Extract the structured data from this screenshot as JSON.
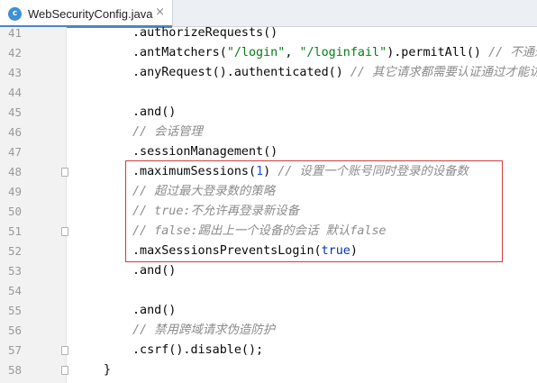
{
  "tab": {
    "icon_letter": "c",
    "title": "WebSecurityConfig.java",
    "close_glyph": "×"
  },
  "lines": [
    {
      "n": "41",
      "indent": "        ",
      "parts": [
        {
          "t": ".authorizeRequests()",
          "c": ""
        }
      ]
    },
    {
      "n": "42",
      "indent": "        ",
      "parts": [
        {
          "t": ".antMatchers(",
          "c": ""
        },
        {
          "t": "\"/login\"",
          "c": "str"
        },
        {
          "t": ", ",
          "c": ""
        },
        {
          "t": "\"/loginfail\"",
          "c": "str"
        },
        {
          "t": ").permitAll() ",
          "c": ""
        },
        {
          "t": "// 不通过",
          "c": "cmt"
        }
      ]
    },
    {
      "n": "43",
      "indent": "        ",
      "parts": [
        {
          "t": ".anyRequest().authenticated() ",
          "c": ""
        },
        {
          "t": "// 其它请求都需要认证通过才能访",
          "c": "cmt"
        }
      ]
    },
    {
      "n": "44",
      "indent": "",
      "parts": []
    },
    {
      "n": "45",
      "indent": "        ",
      "parts": [
        {
          "t": ".and()",
          "c": ""
        }
      ]
    },
    {
      "n": "46",
      "indent": "        ",
      "parts": [
        {
          "t": "// 会话管理",
          "c": "cmt"
        }
      ]
    },
    {
      "n": "47",
      "indent": "        ",
      "parts": [
        {
          "t": ".sessionManagement()",
          "c": ""
        }
      ]
    },
    {
      "n": "48",
      "indent": "        ",
      "fold": true,
      "parts": [
        {
          "t": ".maximumSessions(",
          "c": ""
        },
        {
          "t": "1",
          "c": "num"
        },
        {
          "t": ") ",
          "c": ""
        },
        {
          "t": "// 设置一个账号同时登录的设备数",
          "c": "cmt"
        }
      ]
    },
    {
      "n": "49",
      "indent": "        ",
      "parts": [
        {
          "t": "// 超过最大登录数的策略",
          "c": "cmt"
        }
      ]
    },
    {
      "n": "50",
      "indent": "        ",
      "parts": [
        {
          "t": "// true:不允许再登录新设备",
          "c": "cmt"
        }
      ]
    },
    {
      "n": "51",
      "indent": "        ",
      "fold": true,
      "parts": [
        {
          "t": "// false:踢出上一个设备的会话 默认false",
          "c": "cmt"
        }
      ]
    },
    {
      "n": "52",
      "indent": "        ",
      "parts": [
        {
          "t": ".maxSessionsPreventsLogin(",
          "c": ""
        },
        {
          "t": "true",
          "c": "kw"
        },
        {
          "t": ")",
          "c": ""
        }
      ]
    },
    {
      "n": "53",
      "indent": "        ",
      "parts": [
        {
          "t": ".and()",
          "c": ""
        }
      ]
    },
    {
      "n": "54",
      "indent": "",
      "parts": []
    },
    {
      "n": "55",
      "indent": "        ",
      "parts": [
        {
          "t": ".and()",
          "c": ""
        }
      ]
    },
    {
      "n": "56",
      "indent": "        ",
      "parts": [
        {
          "t": "// 禁用跨域请求伪造防护",
          "c": "cmt"
        }
      ]
    },
    {
      "n": "57",
      "indent": "        ",
      "fold": true,
      "parts": [
        {
          "t": ".csrf().disable();",
          "c": ""
        }
      ]
    },
    {
      "n": "58",
      "indent": "",
      "fold": true,
      "parts": [
        {
          "t": "}",
          "c": ""
        }
      ]
    }
  ],
  "colors": {
    "string": "#067d17",
    "number": "#1750eb",
    "keyword": "#0033b3",
    "comment": "#8c8c8c",
    "highlight_border": "#d33a3a"
  }
}
